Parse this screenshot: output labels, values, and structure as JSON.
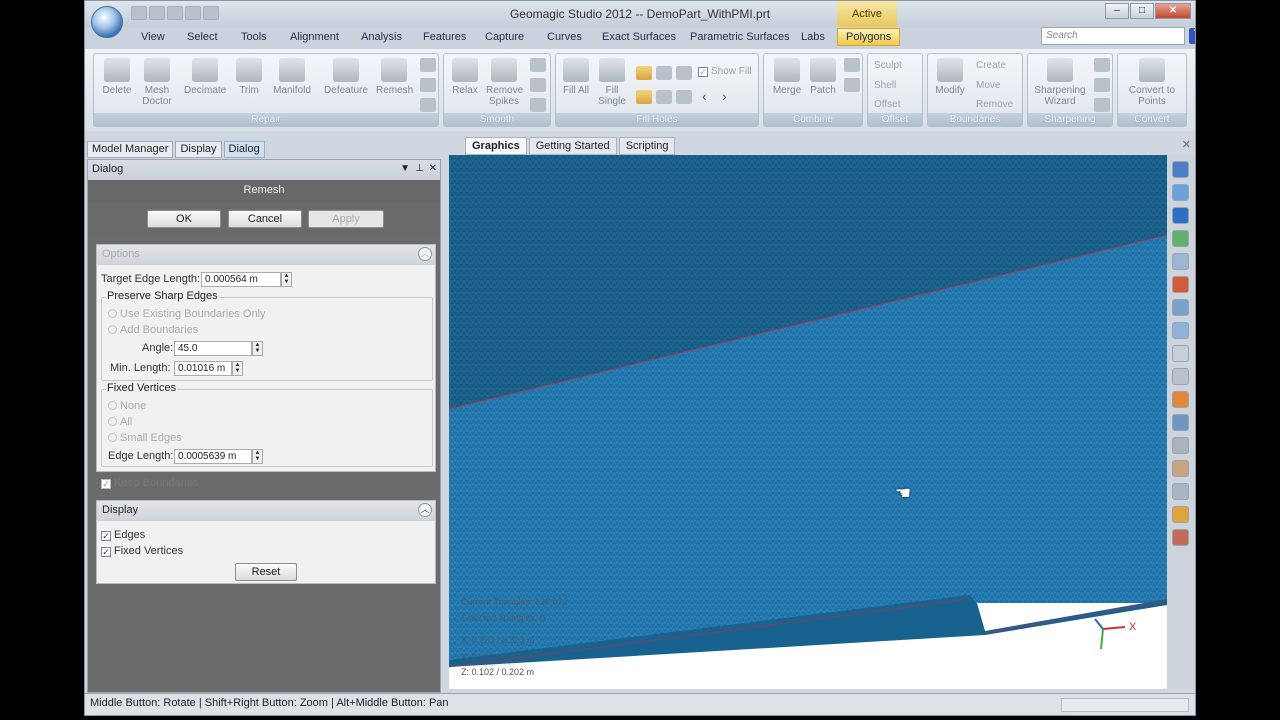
{
  "window": {
    "title": "Geomagic Studio 2012 -- DemoPart_WithPMI.prt",
    "context_tab": "Active"
  },
  "menu_tabs": [
    "View",
    "Select",
    "Tools",
    "Alignment",
    "Analysis",
    "Features",
    "Capture",
    "Curves",
    "Exact Surfaces",
    "Parametric Surfaces",
    "Labs",
    "Polygons"
  ],
  "active_menu_tab": "Polygons",
  "search": {
    "placeholder": "Search"
  },
  "help": "?",
  "ribbon": {
    "repair": {
      "label": "Repair",
      "delete": "Delete",
      "mesh_doctor": "Mesh Doctor",
      "decimate": "Decimate",
      "trim": "Trim",
      "manifold": "Manifold",
      "defeature": "Defeature",
      "remesh": "Remesh"
    },
    "smooth": {
      "label": "Smooth",
      "relax": "Relax",
      "remove_spikes": "Remove Spikes"
    },
    "fill_holes": {
      "label": "Fill Holes",
      "fill_all": "Fill All",
      "fill_single": "Fill Single",
      "show_fill": "Show Fill"
    },
    "combine": {
      "label": "Combine",
      "merge": "Merge",
      "patch": "Patch"
    },
    "offset": {
      "label": "Offset",
      "sculpt": "Sculpt",
      "shell": "Shell",
      "offset": "Offset"
    },
    "boundaries": {
      "label": "Boundaries",
      "modify": "Modify",
      "create": "Create",
      "move": "Move",
      "remove": "Remove"
    },
    "sharpening": {
      "label": "Sharpening",
      "wizard": "Sharpening Wizard"
    },
    "convert": {
      "label": "Convert",
      "to_points": "Convert to Points"
    }
  },
  "panel_tabs": [
    "Model Manager",
    "Display",
    "Dialog"
  ],
  "dialog": {
    "header": "Dialog",
    "title": "Remesh",
    "ok": "OK",
    "cancel": "Cancel",
    "apply": "Apply",
    "options": {
      "header": "Options",
      "target_edge_label": "Target Edge Length:",
      "target_edge_value": "0.000564 m",
      "preserve_header": "Preserve Sharp Edges",
      "use_existing": "Use Existing Boundaries Only",
      "add_boundaries": "Add Boundaries",
      "angle_label": "Angle:",
      "angle_value": "45.0",
      "min_length_label": "Min. Length:",
      "min_length_value": "0.01016 m",
      "fixed_header": "Fixed Vertices",
      "none": "None",
      "all": "All",
      "small_edges": "Small Edges",
      "edge_length_label": "Edge Length:",
      "edge_length_value": "0.0005639 m",
      "keep_boundaries": "Keep Boundaries"
    },
    "display": {
      "header": "Display",
      "edges": "Edges",
      "fixed_vertices": "Fixed Vertices",
      "reset": "Reset"
    }
  },
  "graphics_tabs": [
    "Graphics",
    "Getting Started",
    "Scripting"
  ],
  "viewport": {
    "current_triangles": "Current Triangles: 636,072",
    "selected_triangles": "Selected Triangles: 0",
    "x_range": "X: 0.203 / 0.303 m",
    "y_range": "Y: 0.032 / 0.300 m",
    "z_range": "Z: 0.102 / 0.202 m",
    "axis_x": "X"
  },
  "status_bar": "Middle Button: Rotate | Shift+Right Button: Zoom | Alt+Middle Button: Pan",
  "colors": {
    "mesh": "#1e72a8",
    "mesh_dark": "#155a82",
    "boundary": "#b0304a",
    "accent": "#f1c94a"
  }
}
